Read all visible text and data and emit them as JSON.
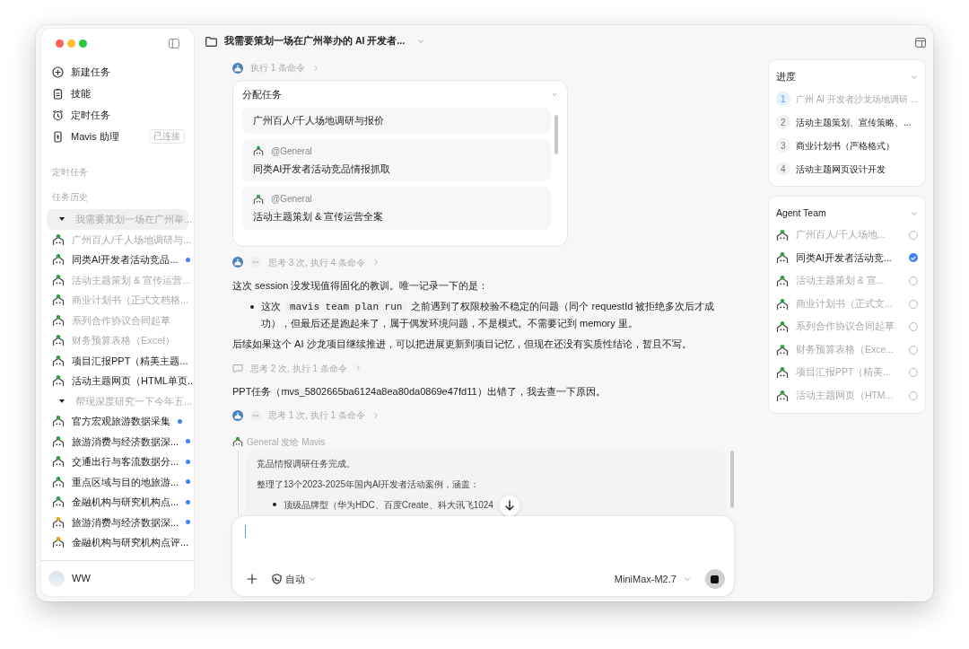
{
  "sidebar": {
    "nav": [
      {
        "kind": "new",
        "label": "新建任务"
      },
      {
        "kind": "skills",
        "label": "技能"
      },
      {
        "kind": "schedule",
        "label": "定时任务"
      },
      {
        "kind": "assistant",
        "label": "Mavis 助理",
        "badge": "已连接"
      }
    ],
    "scheduled_heading": "定时任务",
    "history_heading": "任务历史",
    "history": [
      {
        "title": "我需要策划一场在广州举...",
        "selected": true,
        "muted": true,
        "expanded": true,
        "children": [
          {
            "title": "广州百人/千人场地调研与...",
            "muted": true,
            "unread": false,
            "color": "#2f9e44"
          },
          {
            "title": "同类AI开发者活动竞品...",
            "muted": false,
            "unread": true,
            "color": "#2f9e44"
          },
          {
            "title": "活动主题策划 & 宣传运营...",
            "muted": true,
            "unread": false,
            "color": "#2f9e44"
          },
          {
            "title": "商业计划书（正式文档格...",
            "muted": true,
            "unread": false,
            "color": "#2f9e44"
          },
          {
            "title": "系列合作协议合同起草",
            "muted": true,
            "unread": false,
            "color": "#2f9e44"
          },
          {
            "title": "财务预算表格（Excel）",
            "muted": true,
            "unread": false,
            "color": "#2f9e44"
          },
          {
            "title": "项目汇报PPT（精美主题...",
            "muted": false,
            "unread": false,
            "color": "#2f9e44"
          },
          {
            "title": "活动主题网页（HTML单页...",
            "muted": false,
            "unread": false,
            "color": "#2f9e44"
          }
        ]
      },
      {
        "title": "帮现深度研究一下今年五...",
        "selected": false,
        "muted": true,
        "expanded": true,
        "children": [
          {
            "title": "官方宏观旅游数据采集",
            "muted": false,
            "unread": true,
            "color": "#2f9e44"
          },
          {
            "title": "旅游消费与经济数据深...",
            "muted": false,
            "unread": true,
            "color": "#2f9e44"
          },
          {
            "title": "交通出行与客流数据分...",
            "muted": false,
            "unread": true,
            "color": "#2f9e44"
          },
          {
            "title": "重点区域与目的地旅游...",
            "muted": false,
            "unread": true,
            "color": "#2f9e44"
          },
          {
            "title": "金融机构与研究机构点...",
            "muted": false,
            "unread": true,
            "color": "#2f9e44"
          },
          {
            "title": "旅游消费与经济数据深...",
            "muted": false,
            "unread": true,
            "color": "#e8a317"
          },
          {
            "title": "金融机构与研究机构点评...",
            "muted": false,
            "unread": false,
            "color": "#e8a317"
          }
        ]
      }
    ],
    "user": {
      "name": "WW"
    }
  },
  "header": {
    "title": "我需要策划一场在广州举办的 AI 开发者..."
  },
  "stream": [
    {
      "kind": "step",
      "thinking_dots": false,
      "text": "执行 1 条命令"
    },
    {
      "kind": "task_card",
      "title": "分配任务",
      "expanded": true,
      "tasks": [
        {
          "text": "广州百人/千人场地调研与报价"
        },
        {
          "mention": "@General",
          "text": "同类AI开发者活动竞品情报抓取"
        },
        {
          "mention": "@General",
          "text": "活动主题策划 & 宣传运营全案"
        }
      ]
    },
    {
      "kind": "step",
      "thinking_dots": true,
      "text": "思考 3 次, 执行 4 条命令"
    },
    {
      "kind": "paragraph",
      "text": "这次 session 没发现值得固化的教训。唯一记录一下的是："
    },
    {
      "kind": "bullets",
      "items": [
        {
          "before": "这次",
          "code": "mavis team plan run",
          "after": "之前遇到了权限校验不稳定的问题（同个 requestId 被拒绝多次后才成功），但最后还是跑起来了，属于偶发环境问题，不是模式。不需要记到 memory 里。"
        }
      ]
    },
    {
      "kind": "paragraph",
      "text": "后续如果这个 AI 沙龙项目继续推进，可以把进展更新到项目记忆，但现在还没有实质性结论，暂且不写。"
    },
    {
      "kind": "note_step",
      "thinking_dots": false,
      "text": "思考 2 次, 执行 1 条命令"
    },
    {
      "kind": "paragraph",
      "text": "PPT任务（mvs_5802665ba6124a8ea80da0869e47fd11）出错了，我去查一下原因。"
    },
    {
      "kind": "step",
      "thinking_dots": true,
      "text": "思考 1 次, 执行 1 条命令"
    },
    {
      "kind": "relay",
      "header": "General 发给 Mavis",
      "color": "#2f9e44",
      "lines": [
        "竞品情报调研任务完成。",
        "整理了13个2023-2025年国内AI开发者活动案例，涵盖："
      ],
      "bullets": [
        "顶级品牌型（华为HDC、百度Create、科大讯飞1024"
      ]
    }
  ],
  "composer": {
    "mode": "自动",
    "model": "MiniMax-M2.7",
    "running": true
  },
  "progress": {
    "title": "进度",
    "expanded": true,
    "steps": [
      {
        "number": "1",
        "text": "广州 AI 开发者沙龙场地调研 ...",
        "selected": true
      },
      {
        "number": "2",
        "text": "活动主题策划、宣传策略、...",
        "selected": false
      },
      {
        "number": "3",
        "text": "商业计划书（严格格式）",
        "selected": false
      },
      {
        "number": "4",
        "text": "活动主题网页设计开发",
        "selected": false
      }
    ]
  },
  "team": {
    "title": "Agent Team",
    "expanded": true,
    "members": [
      {
        "name": "广州百人/千人场地...",
        "checked": false
      },
      {
        "name": "同类AI开发者活动竞...",
        "checked": true
      },
      {
        "name": "活动主题策划 & 宣...",
        "checked": false
      },
      {
        "name": "商业计划书（正式文...",
        "checked": false
      },
      {
        "name": "系列合作协议合同起草",
        "checked": false
      },
      {
        "name": "财务预算表格（Exce...",
        "checked": false
      },
      {
        "name": "项目汇报PPT（精美...",
        "checked": false
      },
      {
        "name": "活动主题网页（HTM...",
        "checked": false
      }
    ]
  }
}
